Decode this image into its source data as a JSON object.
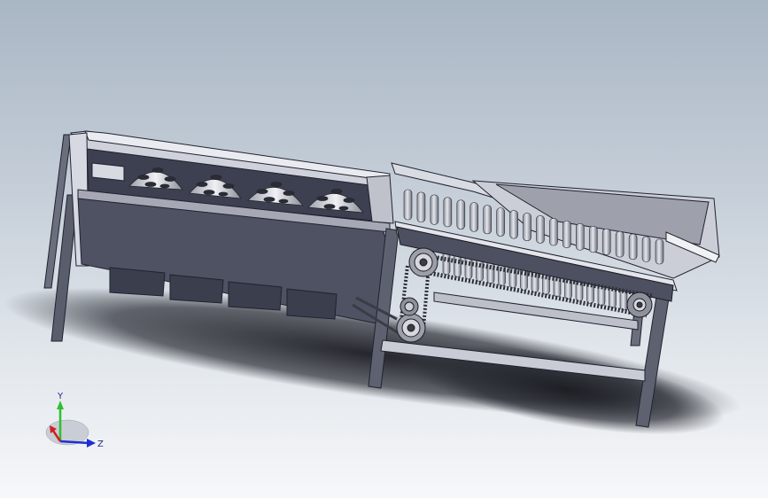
{
  "triad": {
    "axis_y_label": "Y",
    "axis_z_label": "Z",
    "colors": {
      "y": "#2fbf2f",
      "z": "#1f2fd0",
      "x": "#d02020"
    }
  },
  "viewport": {
    "background_top": "#a9b6c4",
    "background_bottom": "#f6f7f9",
    "model_color": "#4f5262"
  }
}
